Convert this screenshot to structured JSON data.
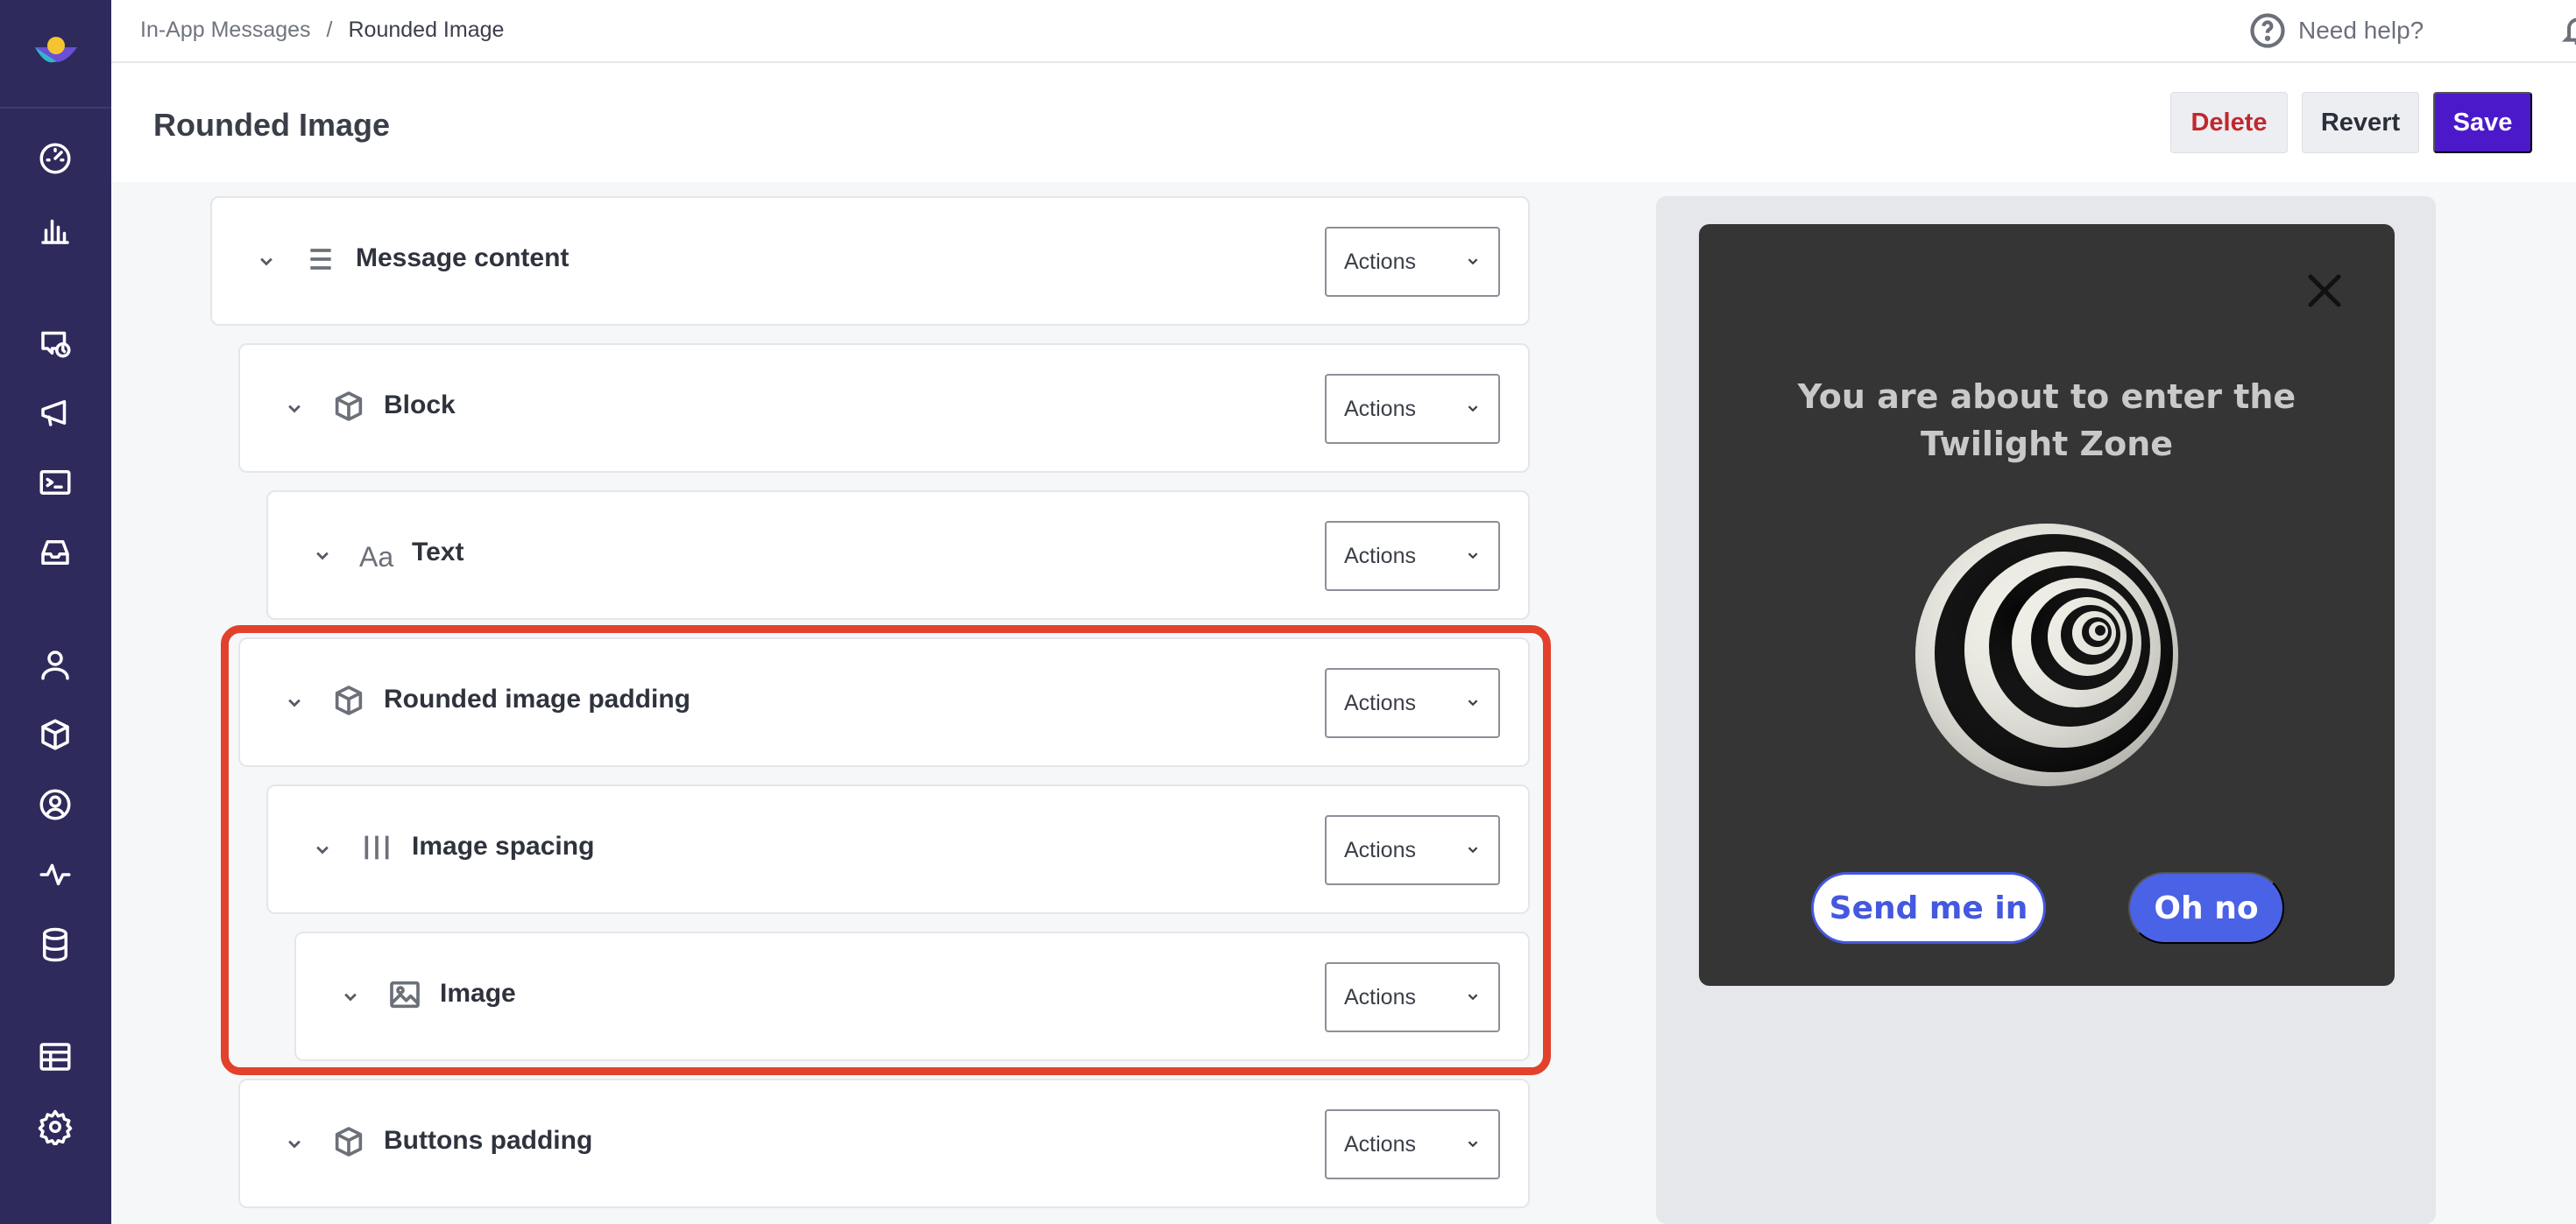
{
  "breadcrumb": {
    "parent": "In-App Messages",
    "separator": "/",
    "current": "Rounded Image"
  },
  "topbar": {
    "help_label": "Need help?"
  },
  "header": {
    "title": "Rounded Image",
    "delete_label": "Delete",
    "revert_label": "Revert",
    "save_label": "Save"
  },
  "tree": {
    "actions_label": "Actions",
    "rows": [
      {
        "label": "Message content",
        "icon": "list-icon"
      },
      {
        "label": "Block",
        "icon": "cube-icon"
      },
      {
        "label": "Text",
        "icon": "text-aa-icon",
        "icon_text": "Aa"
      },
      {
        "label": "Rounded image padding",
        "icon": "cube-icon"
      },
      {
        "label": "Image spacing",
        "icon": "columns-icon"
      },
      {
        "label": "Image",
        "icon": "image-icon"
      },
      {
        "label": "Buttons padding",
        "icon": "cube-icon"
      }
    ]
  },
  "preview": {
    "title": "You are about to enter the Twilight Zone",
    "primary_button": "Send me in",
    "secondary_button": "Oh no"
  },
  "colors": {
    "sidebar": "#2f2a5c",
    "save": "#4b19c9",
    "delete_text": "#c1272d",
    "highlight": "#e2412b",
    "modal_bg": "#353535",
    "modal_button": "#4a62e6"
  }
}
